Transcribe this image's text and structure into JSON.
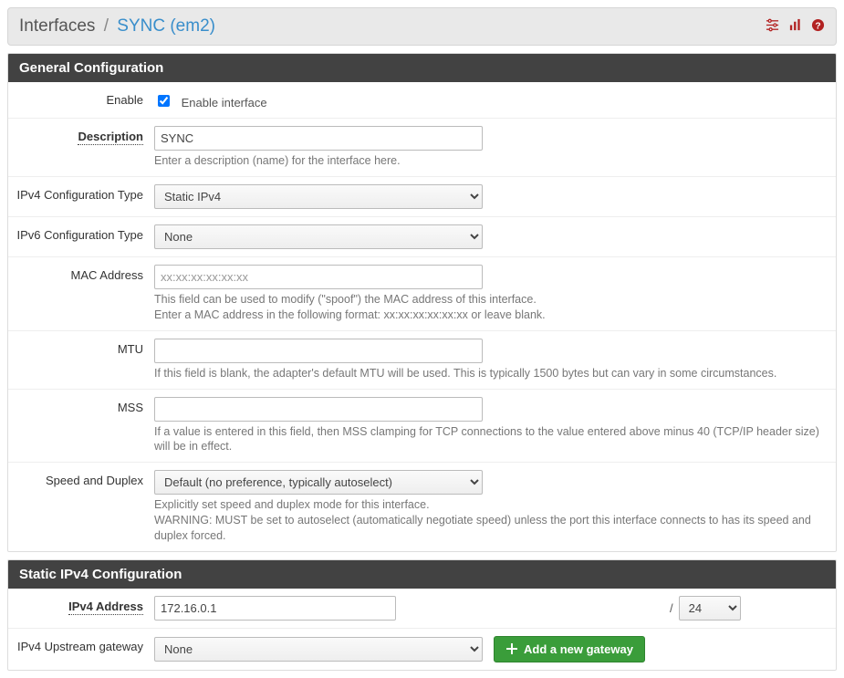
{
  "header": {
    "breadcrumb": {
      "root": "Interfaces",
      "current": "SYNC (em2)"
    },
    "icons": [
      "sliders-icon",
      "chart-icon",
      "help-icon"
    ]
  },
  "panelGeneral": {
    "title": "General Configuration"
  },
  "panelStatic": {
    "title": "Static IPv4 Configuration"
  },
  "fields": {
    "enable": {
      "label": "Enable",
      "checkbox_label": "Enable interface",
      "checked": true
    },
    "description": {
      "label": "Description",
      "value": "SYNC",
      "help": "Enter a description (name) for the interface here."
    },
    "ipv4type": {
      "label": "IPv4 Configuration Type",
      "value": "Static IPv4"
    },
    "ipv6type": {
      "label": "IPv6 Configuration Type",
      "value": "None"
    },
    "mac": {
      "label": "MAC Address",
      "placeholder": "xx:xx:xx:xx:xx:xx",
      "value": "",
      "help1": "This field can be used to modify (\"spoof\") the MAC address of this interface.",
      "help2": "Enter a MAC address in the following format: xx:xx:xx:xx:xx:xx or leave blank."
    },
    "mtu": {
      "label": "MTU",
      "value": "",
      "help": "If this field is blank, the adapter's default MTU will be used. This is typically 1500 bytes but can vary in some circumstances."
    },
    "mss": {
      "label": "MSS",
      "value": "",
      "help": "If a value is entered in this field, then MSS clamping for TCP connections to the value entered above minus 40 (TCP/IP header size) will be in effect."
    },
    "speed": {
      "label": "Speed and Duplex",
      "value": "Default (no preference, typically autoselect)",
      "help1": "Explicitly set speed and duplex mode for this interface.",
      "help2": "WARNING: MUST be set to autoselect (automatically negotiate speed) unless the port this interface connects to has its speed and duplex forced."
    },
    "ipv4addr": {
      "label": "IPv4 Address",
      "value": "172.16.0.1",
      "slash": "/",
      "cidr": "24"
    },
    "gateway": {
      "label": "IPv4 Upstream gateway",
      "value": "None",
      "addbtn": "Add a new gateway"
    }
  }
}
